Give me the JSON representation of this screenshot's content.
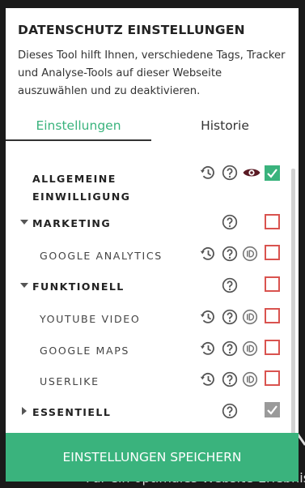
{
  "background_caption": "Für ein optimales Website-Erlebnis",
  "panel": {
    "title": "DATENSCHUTZ EINSTELLUNGEN",
    "description": "Dieses Tool hilft Ihnen, verschiedene Tags, Tracker und Analyse-Tools auf dieser Webseite auszuwählen und zu deaktivieren."
  },
  "tabs": [
    {
      "label": "Einstellungen",
      "active": true
    },
    {
      "label": "Historie",
      "active": false
    }
  ],
  "settings": {
    "general_consent": {
      "line1": "ALLGEMEINE",
      "line2": "EINWILLIGUNG",
      "checked": true
    },
    "marketing": {
      "label": "MARKETING",
      "expanded": true,
      "checked": false
    },
    "google_analytics": {
      "label": "GOOGLE ANALYTICS",
      "checked": false
    },
    "functional": {
      "label": "FUNKTIONELL",
      "expanded": true,
      "checked": false
    },
    "youtube_video": {
      "label": "YOUTUBE VIDEO",
      "checked": false
    },
    "google_maps": {
      "label": "GOOGLE MAPS",
      "checked": false
    },
    "userlike": {
      "label": "USERLIKE",
      "checked": false
    },
    "essential": {
      "label": "ESSENTIELL",
      "expanded": false,
      "checked": true,
      "disabled": true
    }
  },
  "icons": {
    "history": "history-icon",
    "help": "question-circle-icon",
    "eye": "eye-icon",
    "id": "id-badge-icon"
  },
  "colors": {
    "accent": "#3ab37d",
    "unchecked_border": "#d9534f",
    "eye": "#5a1a24",
    "disabled": "#9a9a9a"
  },
  "footer": {
    "save_label": "EINSTELLUNGEN SPEICHERN"
  }
}
